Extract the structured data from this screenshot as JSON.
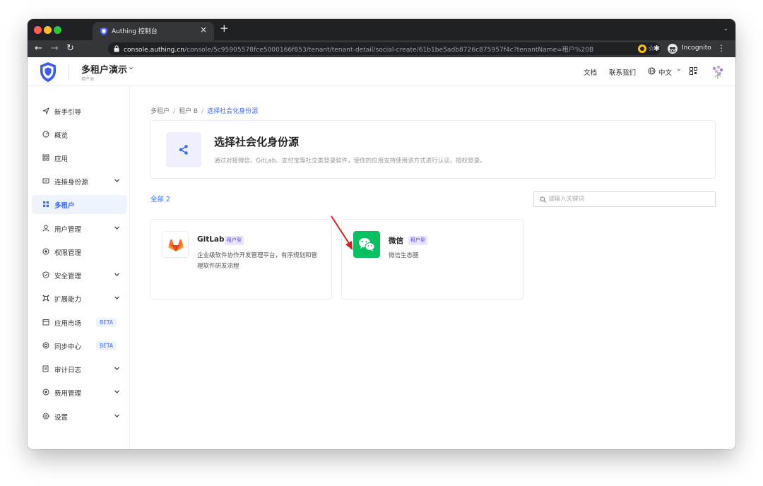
{
  "browser": {
    "tab_title": "Authing 控制台",
    "url_domain": "console.authing.cn",
    "url_path": "/console/5c95905578fce5000166f853/tenant/tenant-detail/social-create/61b1be5adb8726c875957f4c?tenantName=租户%20B",
    "incognito_label": "Incognito"
  },
  "header": {
    "pool_title": "多租户演示",
    "pool_subtitle": "用户池",
    "links": [
      "文档",
      "联系我们"
    ],
    "language": "中文"
  },
  "sidebar": {
    "items": [
      {
        "label": "新手引导",
        "icon": "flag-icon"
      },
      {
        "label": "概览",
        "icon": "dashboard-icon"
      },
      {
        "label": "应用",
        "icon": "apps-icon"
      },
      {
        "label": "连接身份源",
        "icon": "connection-icon",
        "expandable": true
      },
      {
        "label": "多租户",
        "icon": "tenant-icon",
        "active": true
      },
      {
        "label": "用户管理",
        "icon": "user-icon",
        "expandable": true
      },
      {
        "label": "权限管理",
        "icon": "permission-icon"
      },
      {
        "label": "安全管理",
        "icon": "shield-icon",
        "expandable": true
      },
      {
        "label": "扩展能力",
        "icon": "extension-icon",
        "expandable": true
      },
      {
        "label": "应用市场",
        "icon": "market-icon",
        "badge": "BETA"
      },
      {
        "label": "同步中心",
        "icon": "sync-icon",
        "badge": "BETA"
      },
      {
        "label": "审计日志",
        "icon": "audit-icon",
        "expandable": true
      },
      {
        "label": "费用管理",
        "icon": "billing-icon",
        "expandable": true
      },
      {
        "label": "设置",
        "icon": "gear-icon",
        "expandable": true
      }
    ]
  },
  "breadcrumb": [
    "多租户",
    "租户 B",
    "选择社会化身份源"
  ],
  "hero": {
    "title": "选择社会化身份源",
    "description": "通过对接微信、GitLab、支付宝等社交类登录软件，使你的应用支持使用该方式进行认证、授权登录。"
  },
  "filter": {
    "count_label": "全部 2",
    "search_placeholder": "请输入关键词"
  },
  "providers": [
    {
      "name": "GitLab",
      "tag": "租户型",
      "description": "企业级软件协作开发管理平台，有序规划和管理软件研发流程",
      "icon": "gitlab-icon",
      "color": "#e24329"
    },
    {
      "name": "微信",
      "tag": "租户型",
      "description": "微信生态圈",
      "icon": "wechat-icon",
      "color": "#07c160"
    }
  ],
  "colors": {
    "accent": "#396aff",
    "tag_bg": "#e9e6fb",
    "annotation_arrow": "#d81e1e"
  }
}
